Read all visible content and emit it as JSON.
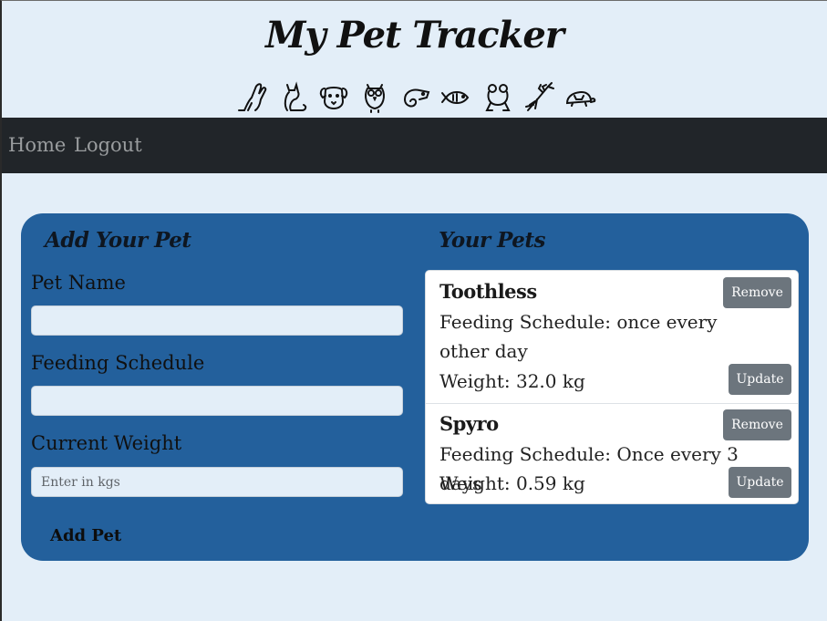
{
  "header": {
    "title": "My Pet Tracker",
    "animal_icons": [
      "rabbit-icon",
      "cat-icon",
      "dog-icon",
      "owl-icon",
      "chameleon-icon",
      "fish-icon",
      "frog-icon",
      "mantis-icon",
      "turtle-icon"
    ]
  },
  "nav": {
    "home": "Home",
    "logout": "Logout"
  },
  "form": {
    "title": "Add Your Pet",
    "name_label": "Pet Name",
    "name_value": "",
    "feeding_label": "Feeding Schedule",
    "feeding_value": "",
    "weight_label": "Current Weight",
    "weight_value": "",
    "weight_placeholder": "Enter in kgs",
    "submit_label": "Add Pet"
  },
  "pets": {
    "title": "Your Pets",
    "remove_label": "Remove",
    "update_label": "Update",
    "items": [
      {
        "name": "Toothless",
        "feeding": "Feeding Schedule: once every other day",
        "weight": "Weight: 32.0 kg"
      },
      {
        "name": "Spyro",
        "feeding": "Feeding Schedule: Once every 3 days",
        "weight": "Weight: 0.59 kg"
      }
    ]
  },
  "colors": {
    "page_bg": "#e3eef8",
    "navbar_bg": "#212529",
    "panel_bg": "#23609c",
    "button_bg": "#6c757d"
  }
}
